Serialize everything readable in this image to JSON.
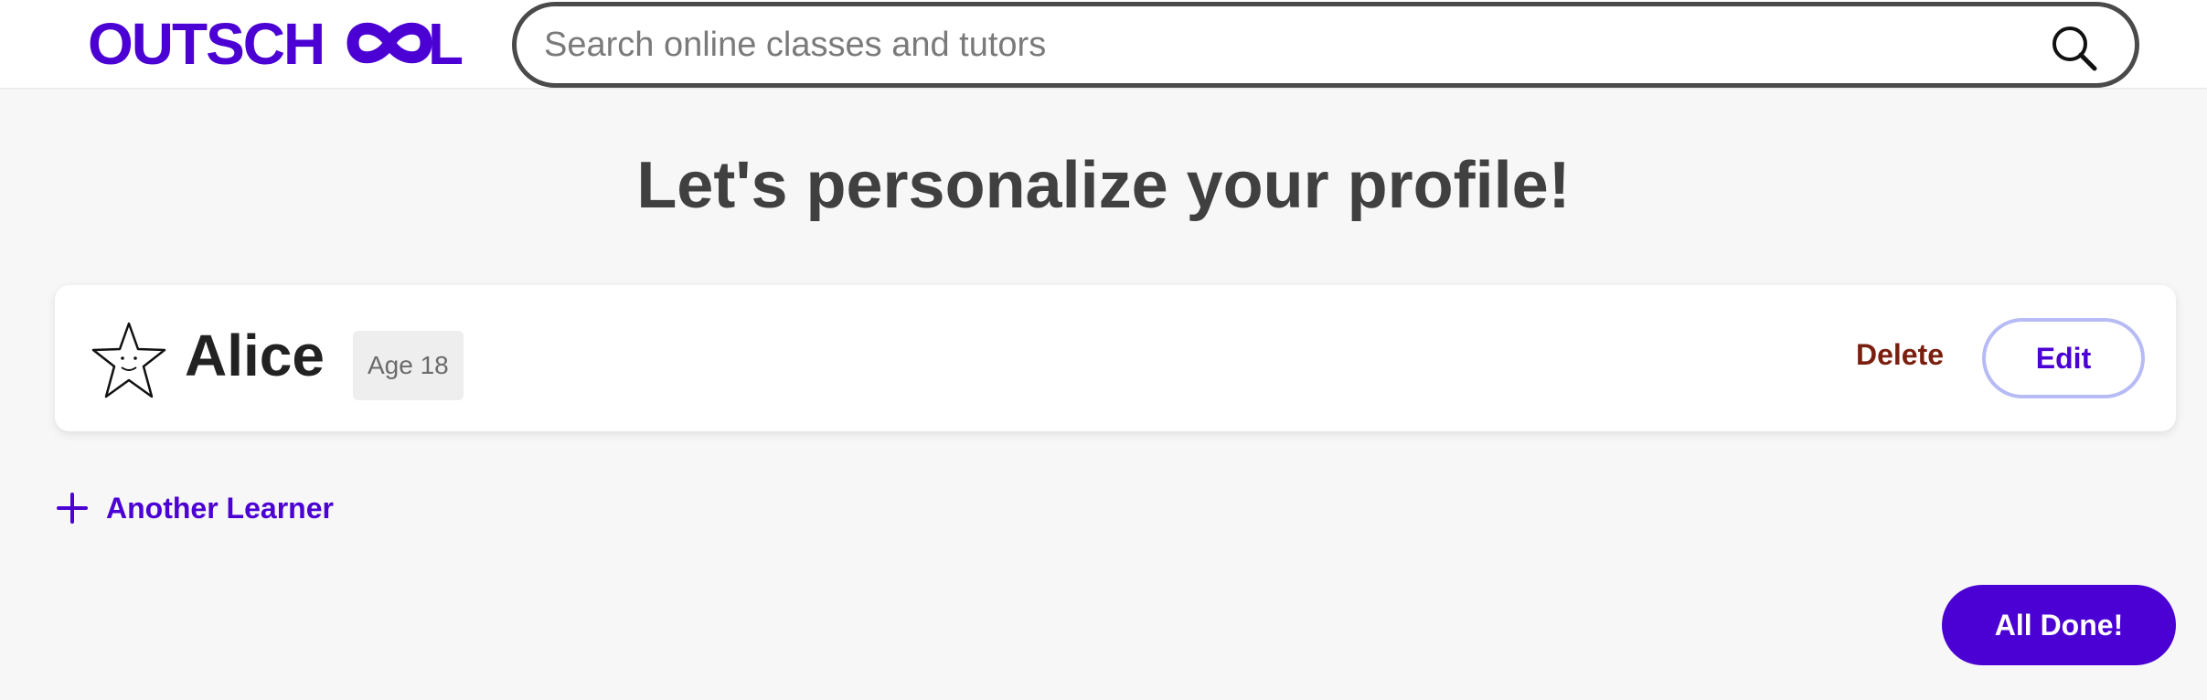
{
  "header": {
    "logo_text": "OUTSCHOOL",
    "brand_color": "#4b01d4",
    "search": {
      "placeholder": "Search online classes and tutors",
      "value": "",
      "icon": "search-icon"
    }
  },
  "main": {
    "title": "Let's personalize your profile!",
    "learners": [
      {
        "name": "Alice",
        "age_label": "Age 18",
        "avatar_icon": "star-icon",
        "delete_label": "Delete",
        "edit_label": "Edit"
      }
    ],
    "add_learner_label": "Another Learner",
    "done_label": "All Done!"
  },
  "colors": {
    "delete": "#7a1f0f",
    "edit_border": "#b6bbf5",
    "background": "#f7f7f7"
  }
}
